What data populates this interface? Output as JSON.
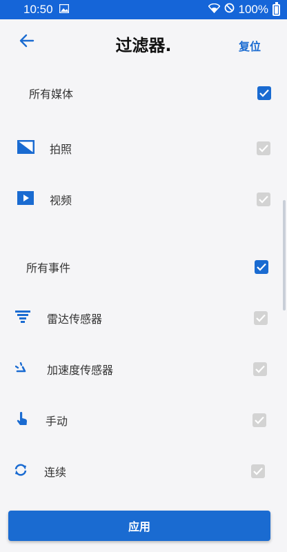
{
  "status_bar": {
    "time": "10:50",
    "battery": "100%"
  },
  "header": {
    "title": "过滤器.",
    "reset_label": "复位"
  },
  "groups": {
    "media": {
      "label": "所有媒体",
      "checked": true,
      "items": [
        {
          "label": "拍照",
          "icon": "photo-icon",
          "checked": true
        },
        {
          "label": "视频",
          "icon": "video-play-icon",
          "checked": true
        }
      ]
    },
    "events": {
      "label": "所有事件",
      "checked": true,
      "items": [
        {
          "label": "雷达传感器",
          "icon": "radar-sensor-icon",
          "checked": true
        },
        {
          "label": "加速度传感器",
          "icon": "accelerometer-icon",
          "checked": true
        },
        {
          "label": "手动",
          "icon": "hand-pointer-icon",
          "checked": true
        },
        {
          "label": "连续",
          "icon": "sync-icon",
          "checked": true
        }
      ]
    }
  },
  "apply_label": "应用",
  "colors": {
    "accent": "#1a6bd1",
    "status_bar": "#1565d8",
    "disabled_checkbox": "#d3d3d3",
    "background": "#f5f5f7"
  }
}
